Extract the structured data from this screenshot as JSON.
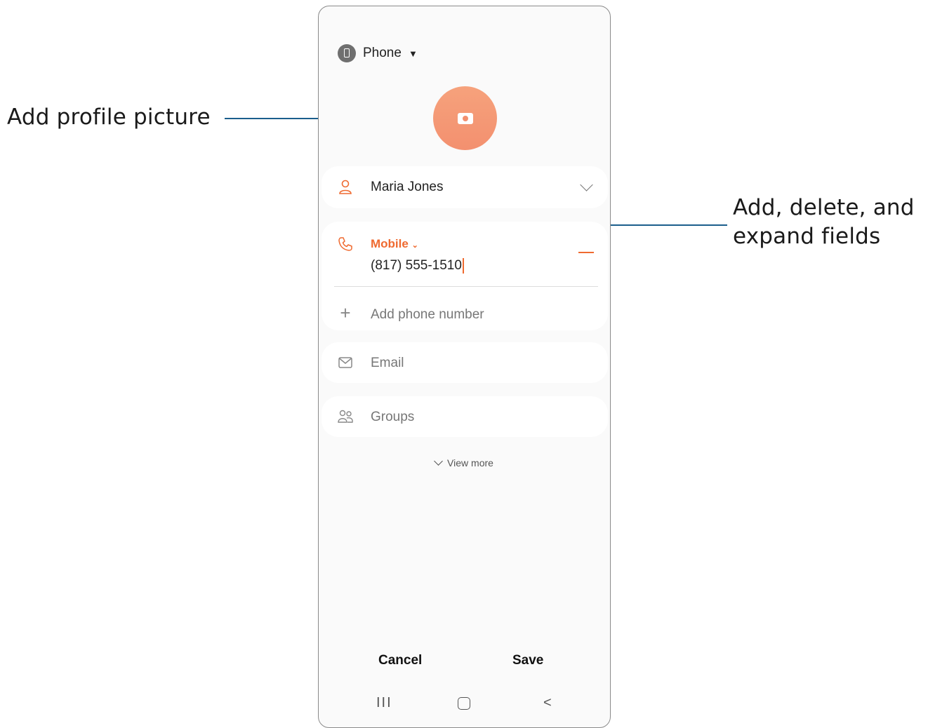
{
  "callouts": {
    "profile_picture": "Add profile picture",
    "fields_line1": "Add, delete, and",
    "fields_line2": "expand fields"
  },
  "storage": {
    "label": "Phone",
    "caret": "▼"
  },
  "fields": {
    "name": "Maria Jones",
    "phone_type": "Mobile",
    "phone_type_chevron": "⌄",
    "phone_number": "(817) 555-1510",
    "add_phone_placeholder": "Add phone number",
    "email_placeholder": "Email",
    "groups_placeholder": "Groups"
  },
  "view_more": "View more",
  "actions": {
    "cancel": "Cancel",
    "save": "Save"
  },
  "nav": {
    "recents": "III",
    "back": "<"
  },
  "colors": {
    "accent": "#ef6a30",
    "callout_line": "#1b5e8c",
    "avatar": "#f3906f"
  },
  "icons": {
    "storage": "phone-device-icon",
    "avatar": "camera-icon",
    "name": "person-icon",
    "phone": "phone-icon",
    "add": "plus-icon",
    "email": "email-icon",
    "groups": "groups-icon",
    "expand": "chevron-down-icon",
    "delete": "minus-icon"
  }
}
